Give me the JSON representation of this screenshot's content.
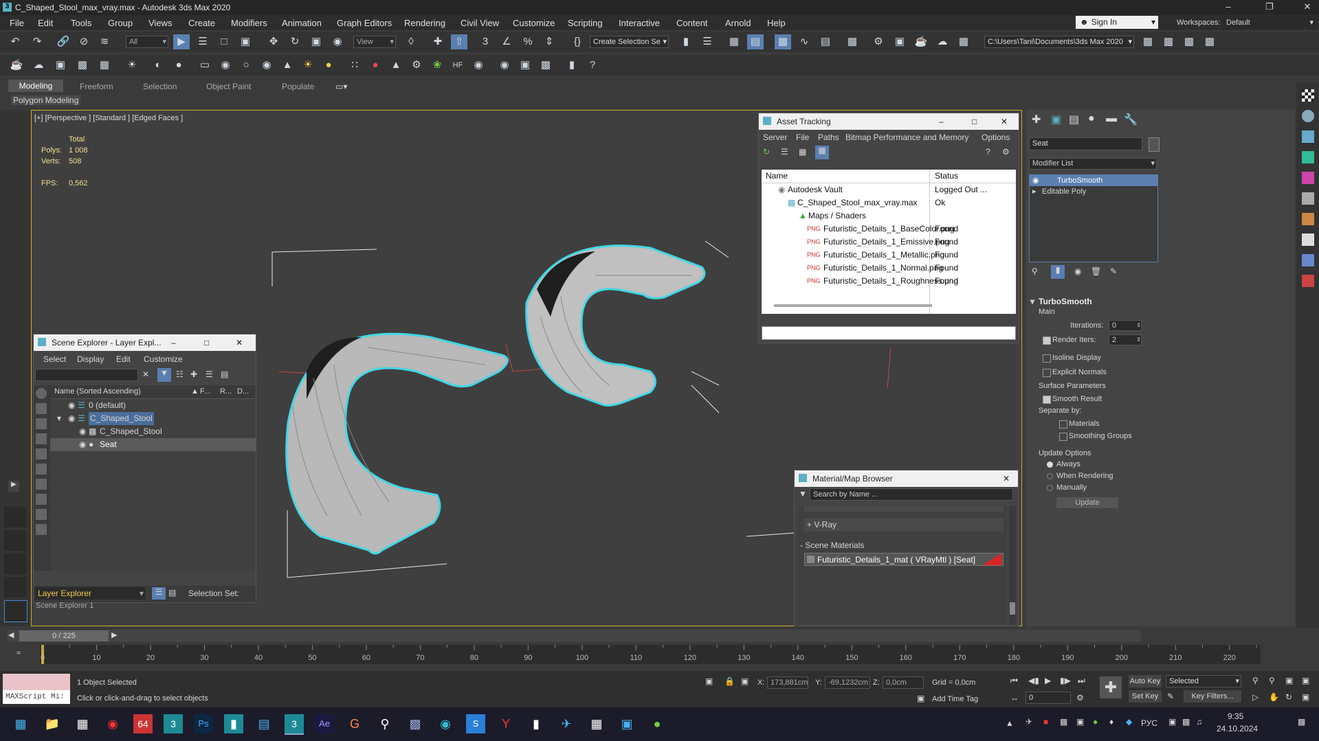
{
  "window": {
    "title": "C_Shaped_Stool_max_vray.max - Autodesk 3ds Max 2020"
  },
  "menu": [
    "File",
    "Edit",
    "Tools",
    "Group",
    "Views",
    "Create",
    "Modifiers",
    "Animation",
    "Graph Editors",
    "Rendering",
    "Civil View",
    "Customize",
    "Scripting",
    "Interactive",
    "Content",
    "Arnold",
    "Help"
  ],
  "account": {
    "sign_in": "Sign In",
    "workspaces_label": "Workspaces:",
    "workspace": "Default"
  },
  "toolbar": {
    "filter": "All",
    "ref_coord": "View",
    "selection_set": "Create Selection Se",
    "path": "C:\\Users\\Tani\\Documents\\3ds Max 2020"
  },
  "ribbon": {
    "tabs": [
      "Modeling",
      "Freeform",
      "Selection",
      "Object Paint",
      "Populate"
    ],
    "sub": "Polygon Modeling"
  },
  "viewport": {
    "label": "[+] [Perspective ] [Standard ] [Edged Faces ]",
    "stats": {
      "total": "Total",
      "polys_label": "Polys:",
      "polys": "1 008",
      "verts_label": "Verts:",
      "verts": "508",
      "fps_label": "FPS:",
      "fps": "0,562"
    }
  },
  "scene_explorer": {
    "title": "Scene Explorer - Layer Expl...",
    "menu": [
      "Select",
      "Display",
      "Edit",
      "Customize"
    ],
    "header": {
      "name": "Name (Sorted Ascending)",
      "f": "F...",
      "r": "R...",
      "d": "D..."
    },
    "rows": [
      "0 (default)",
      "C_Shaped_Stool",
      "C_Shaped_Stool",
      "Seat"
    ],
    "footer": {
      "explorer": "Layer Explorer",
      "selection_set": "Selection Set:",
      "scene_explorer": "Scene Explorer 1"
    }
  },
  "asset_tracking": {
    "title": "Asset Tracking",
    "menu": [
      "Server",
      "File",
      "Paths",
      "Bitmap Performance and Memory",
      "Options"
    ],
    "columns": [
      "Name",
      "Status"
    ],
    "rows": [
      {
        "name": "Autodesk Vault",
        "status": "Logged Out ..."
      },
      {
        "name": "C_Shaped_Stool_max_vray.max",
        "status": "Ok"
      },
      {
        "name": "Maps / Shaders",
        "status": ""
      },
      {
        "name": "Futuristic_Details_1_BaseColor.png",
        "status": "Found"
      },
      {
        "name": "Futuristic_Details_1_Emissive.png",
        "status": "Found"
      },
      {
        "name": "Futuristic_Details_1_Metallic.png",
        "status": "Found"
      },
      {
        "name": "Futuristic_Details_1_Normal.png",
        "status": "Found"
      },
      {
        "name": "Futuristic_Details_1_Roughness.png",
        "status": "Found"
      }
    ]
  },
  "material_browser": {
    "title": "Material/Map Browser",
    "search": "Search by Name ...",
    "vray": "+ V-Ray",
    "scene_materials": "- Scene Materials",
    "material": "Futuristic_Details_1_mat  ( VRayMtl )  [Seat]"
  },
  "command_panel": {
    "object_name": "Seat",
    "modifier_list": "Modifier List",
    "stack": [
      "TurboSmooth",
      "Editable Poly"
    ],
    "rollout": "TurboSmooth",
    "main": "Main",
    "iterations_label": "Iterations:",
    "iterations": "0",
    "render_iters_label": "Render Iters:",
    "render_iters": "2",
    "isoline": "Isoline Display",
    "explicit_normals": "Explicit Normals",
    "surface_params": "Surface Parameters",
    "smooth_result": "Smooth Result",
    "separate_by": "Separate by:",
    "materials": "Materials",
    "smoothing_groups": "Smoothing Groups",
    "update_options": "Update Options",
    "always": "Always",
    "when_rendering": "When Rendering",
    "manually": "Manually",
    "update_btn": "Update"
  },
  "timeline": {
    "frame": "0 / 225",
    "ticks": [
      "0",
      "10",
      "20",
      "30",
      "40",
      "50",
      "60",
      "70",
      "80",
      "90",
      "100",
      "110",
      "120",
      "130",
      "140",
      "150",
      "160",
      "170",
      "180",
      "190",
      "200",
      "210",
      "220"
    ]
  },
  "status": {
    "maxscript": "MAXScript Mi:",
    "selected": "1 Object Selected",
    "prompt": "Click or click-and-drag to select objects",
    "x_label": "X:",
    "x": "173,881cm",
    "y_label": "Y:",
    "y": "-69,1232cm",
    "z_label": "Z:",
    "z": "0,0cm",
    "grid": "Grid = 0,0cm",
    "add_time_tag": "Add Time Tag",
    "auto_key": "Auto Key",
    "set_key": "Set Key",
    "selected_dd": "Selected",
    "key_filters": "Key Filters...",
    "frame_field": "0"
  },
  "taskbar": {
    "lang": "РУС",
    "time": "9:35",
    "date": "24.10.2024"
  }
}
